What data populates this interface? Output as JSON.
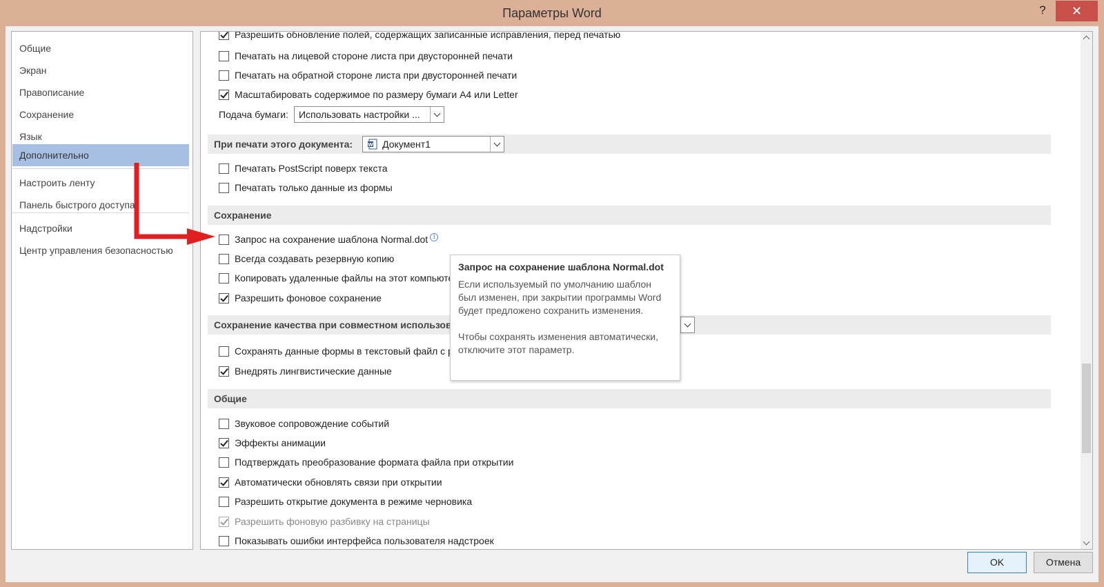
{
  "window": {
    "title": "Параметры Word",
    "help_label": "?",
    "close_label": "✕"
  },
  "colors": {
    "accent_close": "#c7504a",
    "nav_selected": "#a8bfe4",
    "arrow": "#e02020"
  },
  "nav": {
    "items": [
      {
        "label": "Общие"
      },
      {
        "label": "Экран"
      },
      {
        "label": "Правописание"
      },
      {
        "label": "Сохранение"
      },
      {
        "label": "Язык"
      },
      {
        "label": "Дополнительно",
        "selected": true
      },
      {
        "label": "Настроить ленту"
      },
      {
        "label": "Панель быстрого доступа"
      },
      {
        "label": "Надстройки"
      },
      {
        "label": "Центр управления безопасностью"
      }
    ]
  },
  "panel": {
    "print_rows": [
      {
        "label": "Разрешить обновление полей, содержащих записанные исправления, перед печатью",
        "checked": true
      },
      {
        "label": "Печатать на лицевой стороне листа при двусторонней печати",
        "checked": false
      },
      {
        "label": "Печатать на обратной стороне листа при двусторонней печати",
        "checked": false
      },
      {
        "label": "Масштабировать содержимое по размеру бумаги A4 или Letter",
        "checked": true
      }
    ],
    "paper_feed": {
      "label": "Подача бумаги:",
      "value": "Использовать настройки ..."
    },
    "print_doc_section": {
      "label": "При печати этого документа:",
      "document": "Документ1"
    },
    "print_doc_rows": [
      {
        "label": "Печатать PostScript поверх текста",
        "checked": false
      },
      {
        "label": "Печатать только данные из формы",
        "checked": false
      }
    ],
    "save_section": {
      "label": "Сохранение"
    },
    "save_rows": [
      {
        "label": "Запрос на сохранение шаблона Normal.dot",
        "checked": false
      },
      {
        "label": "Всегда создавать резервную копию",
        "checked": false
      },
      {
        "label": "Копировать удаленные файлы на этот компьютер",
        "checked": false
      },
      {
        "label": "Разрешить фоновое сохранение",
        "checked": true
      }
    ],
    "quality_section": {
      "label": "Сохранение качества при совместном использовании документа:"
    },
    "quality_rows": [
      {
        "label": "Сохранять данные формы в текстовый файл с разделителями",
        "checked": false
      },
      {
        "label": "Внедрять лингвистические данные",
        "checked": true
      }
    ],
    "general_section": {
      "label": "Общие"
    },
    "general_rows": [
      {
        "label": "Звуковое сопровождение событий",
        "checked": false
      },
      {
        "label": "Эффекты анимации",
        "checked": true
      },
      {
        "label": "Подтверждать преобразование формата файла при открытии",
        "checked": false
      },
      {
        "label": "Автоматически обновлять связи при открытии",
        "checked": true
      },
      {
        "label": "Разрешить открытие документа в режиме черновика",
        "checked": false
      },
      {
        "label": "Разрешить фоновую разбивку на страницы",
        "checked": true,
        "disabled": true
      },
      {
        "label": "Показывать ошибки интерфейса пользователя надстроек",
        "checked": false
      }
    ]
  },
  "tooltip": {
    "title": "Запрос на сохранение шаблона Normal.dot",
    "body": "Если используемый по умолчанию шаблон был изменен, при закрытии программы Word будет предложено сохранить изменения.\n\nЧтобы сохранять изменения автоматически, отключите этот параметр."
  },
  "buttons": {
    "ok": "OK",
    "cancel": "Отмена"
  }
}
